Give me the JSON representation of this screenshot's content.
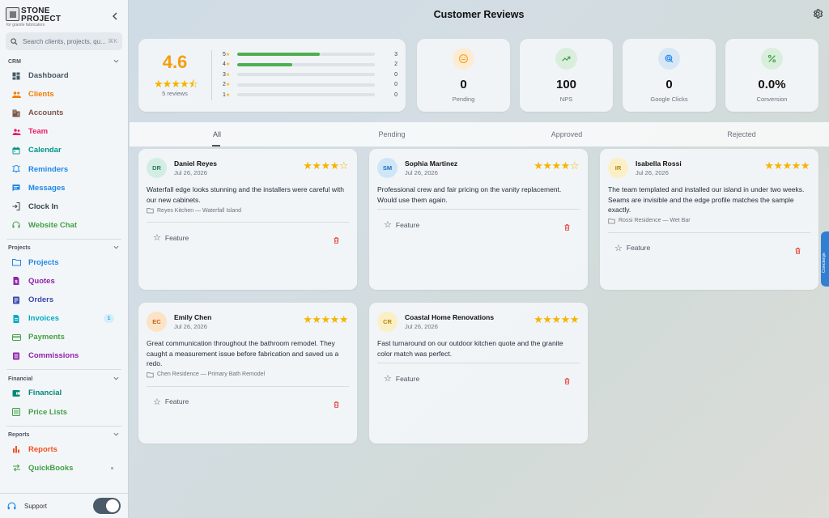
{
  "brand": {
    "name_line1": "STONE",
    "name_line2": "PROJECT",
    "tagline": "for granite fabricators"
  },
  "search": {
    "placeholder": "Search clients, projects, qu...",
    "shortcut": "⌘K"
  },
  "sidebar": {
    "sections": [
      {
        "title": "CRM",
        "items": [
          {
            "label": "Dashboard",
            "color": "#455a64",
            "icon": "dashboard-icon"
          },
          {
            "label": "Clients",
            "color": "#f57c00",
            "icon": "people-icon"
          },
          {
            "label": "Accounts",
            "color": "#795548",
            "icon": "building-icon"
          },
          {
            "label": "Team",
            "color": "#e91e63",
            "icon": "team-icon"
          },
          {
            "label": "Calendar",
            "color": "#009688",
            "icon": "calendar-icon"
          },
          {
            "label": "Reminders",
            "color": "#1e88e5",
            "icon": "bell-icon"
          },
          {
            "label": "Messages",
            "color": "#1e88e5",
            "icon": "message-icon"
          },
          {
            "label": "Clock In",
            "color": "#37474f",
            "icon": "login-icon"
          },
          {
            "label": "Website Chat",
            "color": "#43a047",
            "icon": "headset-icon"
          }
        ]
      },
      {
        "title": "Projects",
        "items": [
          {
            "label": "Projects",
            "color": "#1e88e5",
            "icon": "folder-icon"
          },
          {
            "label": "Quotes",
            "color": "#8e24aa",
            "icon": "quote-icon"
          },
          {
            "label": "Orders",
            "color": "#3949ab",
            "icon": "orders-icon"
          },
          {
            "label": "Invoices",
            "color": "#00acc1",
            "icon": "invoice-icon",
            "badge": "1"
          },
          {
            "label": "Payments",
            "color": "#43a047",
            "icon": "payment-icon"
          },
          {
            "label": "Commissions",
            "color": "#8e24aa",
            "icon": "commission-icon"
          }
        ]
      },
      {
        "title": "Financial",
        "items": [
          {
            "label": "Financial",
            "color": "#00897b",
            "icon": "wallet-icon"
          },
          {
            "label": "Price Lists",
            "color": "#43a047",
            "icon": "list-icon"
          }
        ]
      },
      {
        "title": "Reports",
        "items": [
          {
            "label": "Reports",
            "color": "#f4511e",
            "icon": "chart-icon"
          },
          {
            "label": "QuickBooks",
            "color": "#43a047",
            "icon": "sync-icon",
            "dot": true
          }
        ]
      }
    ],
    "footer": {
      "support_label": "Support"
    }
  },
  "header": {
    "title": "Customer Reviews"
  },
  "rating": {
    "average": "4.6",
    "stars": "★★★★⯪",
    "review_count": "5 reviews",
    "distribution": [
      {
        "star": "5",
        "count": "3",
        "fraction": 0.6
      },
      {
        "star": "4",
        "count": "2",
        "fraction": 0.4
      },
      {
        "star": "3",
        "count": "0",
        "fraction": 0
      },
      {
        "star": "2",
        "count": "0",
        "fraction": 0
      },
      {
        "star": "1",
        "count": "0",
        "fraction": 0
      }
    ]
  },
  "stats": [
    {
      "value": "0",
      "label": "Pending",
      "icon": "smile-icon",
      "color": "#f59e0b",
      "bg": "#fdebd3"
    },
    {
      "value": "100",
      "label": "NPS",
      "icon": "trending-up-icon",
      "color": "#43a047",
      "bg": "#d9eedd"
    },
    {
      "value": "0",
      "label": "Google Clicks",
      "icon": "click-icon",
      "color": "#1e88e5",
      "bg": "#d8e7f6"
    },
    {
      "value": "0.0%",
      "label": "Conversion",
      "icon": "percent-icon",
      "color": "#43a047",
      "bg": "#d9eedd"
    }
  ],
  "tabs": [
    "All",
    "Pending",
    "Approved",
    "Rejected"
  ],
  "reviews": [
    {
      "initials": "DR",
      "name": "Daniel Reyes",
      "date": "Jul 26, 2026",
      "stars": "★★★★☆",
      "text": "Waterfall edge looks stunning and the installers were careful with our new cabinets.",
      "project": "Reyes Kitchen — Waterfall Island",
      "feature_label": "Feature",
      "avatar_bg": "#d3ede4",
      "avatar_color": "#2e7d5b"
    },
    {
      "initials": "SM",
      "name": "Sophia Martinez",
      "date": "Jul 26, 2026",
      "stars": "★★★★☆",
      "text": "Professional crew and fair pricing on the vanity replacement. Would use them again.",
      "project": "",
      "feature_label": "Feature",
      "avatar_bg": "#cfe6f8",
      "avatar_color": "#1e6fb8"
    },
    {
      "initials": "IR",
      "name": "Isabella Rossi",
      "date": "Jul 26, 2026",
      "stars": "★★★★★",
      "text": "The team templated and installed our island in under two weeks. Seams are invisible and the edge profile matches the sample exactly.",
      "project": "Rossi Residence — Wet Bar",
      "feature_label": "Feature",
      "avatar_bg": "#fbefc6",
      "avatar_color": "#b8860b"
    },
    {
      "initials": "EC",
      "name": "Emily Chen",
      "date": "Jul 26, 2026",
      "stars": "★★★★★",
      "text": "Great communication throughout the bathroom remodel. They caught a measurement issue before fabrication and saved us a redo.",
      "project": "Chen Residence — Primary Bath Remodel",
      "feature_label": "Feature",
      "avatar_bg": "#fde3c5",
      "avatar_color": "#c0651a"
    },
    {
      "initials": "CR",
      "name": "Coastal Home Renovations",
      "date": "Jul 26, 2026",
      "stars": "★★★★★",
      "text": "Fast turnaround on our outdoor kitchen quote and the granite color match was perfect.",
      "project": "",
      "feature_label": "Feature",
      "avatar_bg": "#fbefc6",
      "avatar_color": "#b8860b"
    }
  ],
  "side_tab": {
    "label": "Concierge"
  }
}
